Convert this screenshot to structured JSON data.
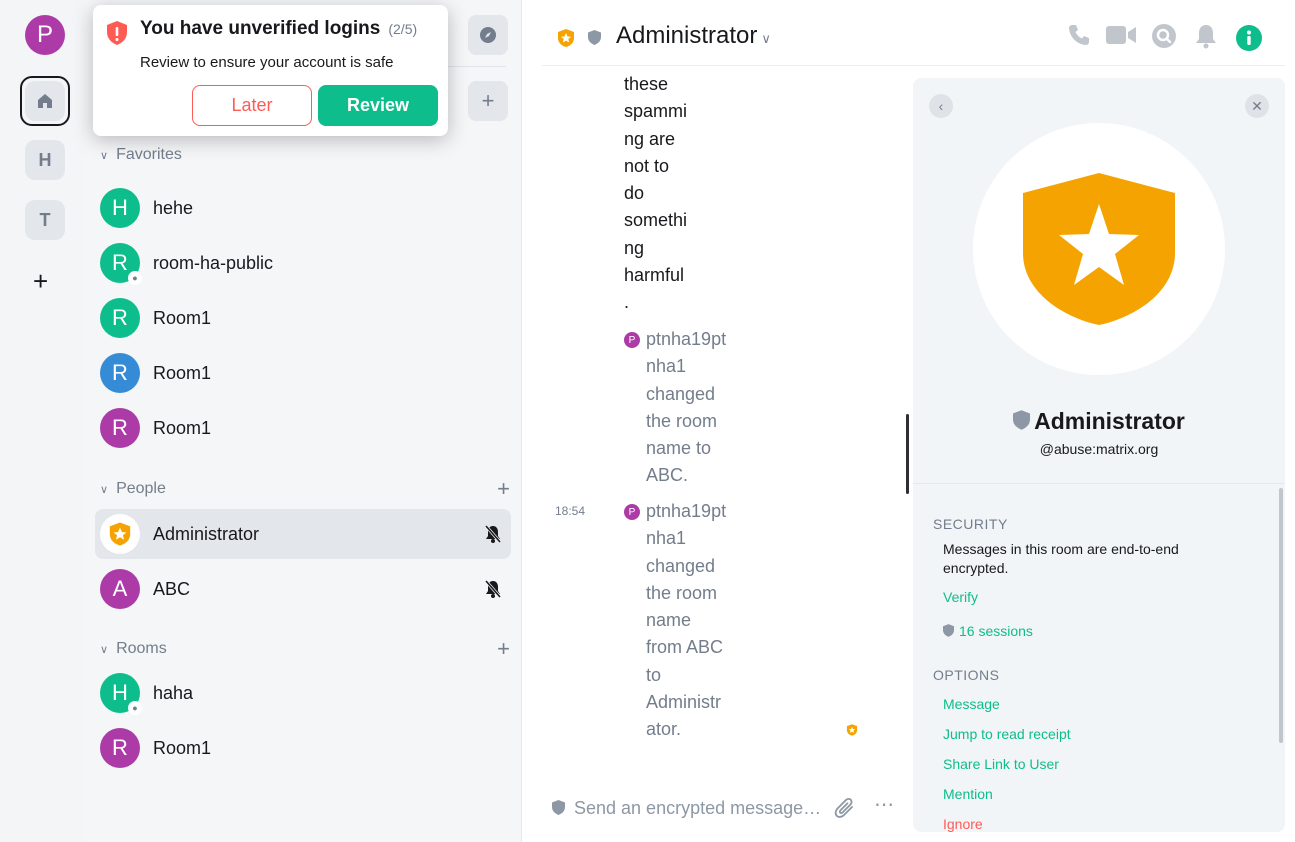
{
  "spaces": {
    "user_initial": "P",
    "items": [
      {
        "label": "H"
      },
      {
        "label": "T"
      }
    ]
  },
  "toast": {
    "title": "You have unverified logins",
    "count": "(2/5)",
    "body": "Review to ensure your account is safe",
    "later": "Later",
    "review": "Review"
  },
  "roomlist": {
    "favorites_label": "Favorites",
    "people_label": "People",
    "rooms_label": "Rooms",
    "favorites": [
      {
        "initial": "H",
        "name": "hehe",
        "color": "#0dbd8b",
        "public": false
      },
      {
        "initial": "R",
        "name": "room-ha-public",
        "color": "#0dbd8b",
        "public": true
      },
      {
        "initial": "R",
        "name": "Room1",
        "color": "#0dbd8b",
        "public": false
      },
      {
        "initial": "R",
        "name": "Room1",
        "color": "#368bd6",
        "public": false
      },
      {
        "initial": "R",
        "name": "Room1",
        "color": "#ac3ba8",
        "public": false
      }
    ],
    "people": [
      {
        "initial": "",
        "name": "Administrator",
        "color": "#ffffff",
        "muted": true,
        "selected": true
      },
      {
        "initial": "A",
        "name": "ABC",
        "color": "#ac3ba8",
        "muted": true,
        "selected": false
      }
    ],
    "rooms": [
      {
        "initial": "H",
        "name": "haha",
        "color": "#0dbd8b",
        "public": true
      },
      {
        "initial": "R",
        "name": "Room1",
        "color": "#ac3ba8",
        "public": false
      }
    ]
  },
  "header": {
    "title": "Administrator"
  },
  "timeline": {
    "message_lines": [
      "these",
      "spammi",
      "ng are",
      "not to",
      "do",
      "somethi",
      "ng",
      "harmful",
      "."
    ],
    "event1": {
      "avatar": "P",
      "lines": [
        "ptnha19pt",
        "nha1",
        "changed",
        "the room",
        "name to",
        "ABC."
      ]
    },
    "event2": {
      "time": "18:54",
      "avatar": "P",
      "lines": [
        "ptnha19pt",
        "nha1",
        "changed",
        "the room",
        "name",
        "from ABC",
        "to",
        "Administr",
        "ator."
      ]
    }
  },
  "composer": {
    "placeholder": "Send an encrypted message…"
  },
  "right_panel": {
    "name": "Administrator",
    "mxid": "@abuse:matrix.org",
    "security_label": "SECURITY",
    "security_text": "Messages in this room are end-to-end encrypted.",
    "verify": "Verify",
    "sessions": "16 sessions",
    "options_label": "OPTIONS",
    "options": [
      "Message",
      "Jump to read receipt",
      "Share Link to User",
      "Mention"
    ],
    "danger": "Ignore"
  },
  "colors": {
    "accent": "#0dbd8b",
    "danger": "#ff5b55",
    "shield_gold": "#f5a300"
  }
}
